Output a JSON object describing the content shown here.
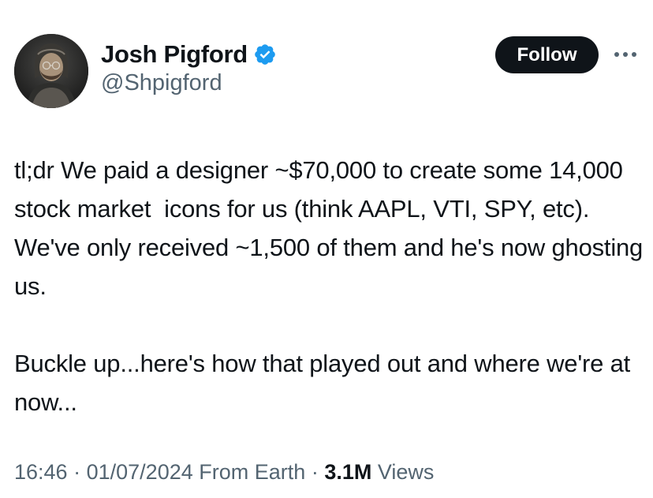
{
  "author": {
    "display_name": "Josh Pigford",
    "handle": "@Shpigford",
    "verified": true
  },
  "actions": {
    "follow_label": "Follow",
    "more_icon": "more-horizontal-icon"
  },
  "tweet": {
    "paragraphs": [
      "tl;dr We paid a designer ~$70,000 to create some 14,000 stock market  icons for us (think AAPL, VTI, SPY, etc). We've only received ~1,500 of them and he's now ghosting us.",
      "Buckle up...here's how that played out and where we're at now..."
    ]
  },
  "meta": {
    "time": "16:46",
    "date": "01/07/2024",
    "source": "From Earth",
    "views_count": "3.1M",
    "views_label": "Views",
    "separator": "·"
  },
  "colors": {
    "text_primary": "#0f1419",
    "text_secondary": "#536471",
    "verified_blue": "#1d9bf0",
    "follow_bg": "#0f1419"
  }
}
